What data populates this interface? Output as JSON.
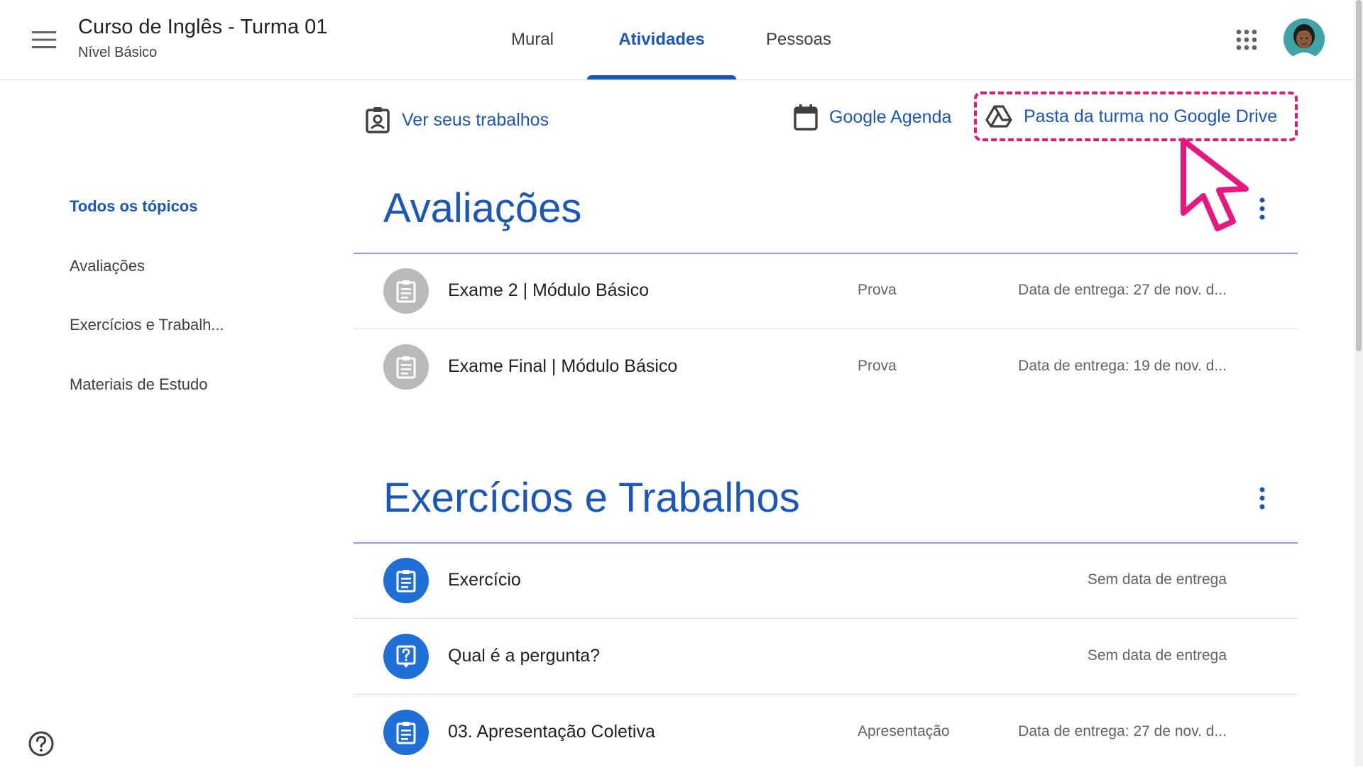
{
  "header": {
    "class_title": "Curso de Inglês - Turma 01",
    "class_subtitle": "Nível Básico",
    "tabs": [
      {
        "label": "Mural"
      },
      {
        "label": "Atividades"
      },
      {
        "label": "Pessoas"
      }
    ]
  },
  "sidebar": {
    "items": [
      {
        "label": "Todos os tópicos"
      },
      {
        "label": "Avaliações"
      },
      {
        "label": "Exercícios e Trabalh..."
      },
      {
        "label": "Materiais de Estudo"
      }
    ]
  },
  "toolbar": {
    "view_work_label": "Ver seus trabalhos",
    "calendar_label": "Google Agenda",
    "drive_label": "Pasta da turma no Google Drive"
  },
  "sections": [
    {
      "title": "Avaliações",
      "items": [
        {
          "title": "Exame 2 | Módulo Básico",
          "type": "Prova",
          "due": "Data de entrega: 27 de nov. d..."
        },
        {
          "title": "Exame Final | Módulo Básico",
          "type": "Prova",
          "due": "Data de entrega: 19 de nov. d..."
        }
      ]
    },
    {
      "title": "Exercícios e Trabalhos",
      "items": [
        {
          "title": "Exercício",
          "type": "",
          "due": "Sem data de entrega"
        },
        {
          "title": "Qual é a pergunta?",
          "type": "",
          "due": "Sem data de entrega"
        },
        {
          "title": "03. Apresentação Coletiva",
          "type": "Apresentação",
          "due": "Data de entrega: 27 de nov. d..."
        }
      ]
    }
  ],
  "colors": {
    "accent": "#1a57b8",
    "highlight": "#e8177f",
    "assignment_icon": "#1f6fd6",
    "exam_icon": "#b9b9b9"
  },
  "icons": [
    "menu-icon",
    "apps-grid-icon",
    "avatar",
    "id-badge-icon",
    "calendar-icon",
    "drive-icon",
    "more-vert-icon",
    "assignment-icon",
    "question-icon",
    "help-icon",
    "cursor-arrow-icon"
  ]
}
